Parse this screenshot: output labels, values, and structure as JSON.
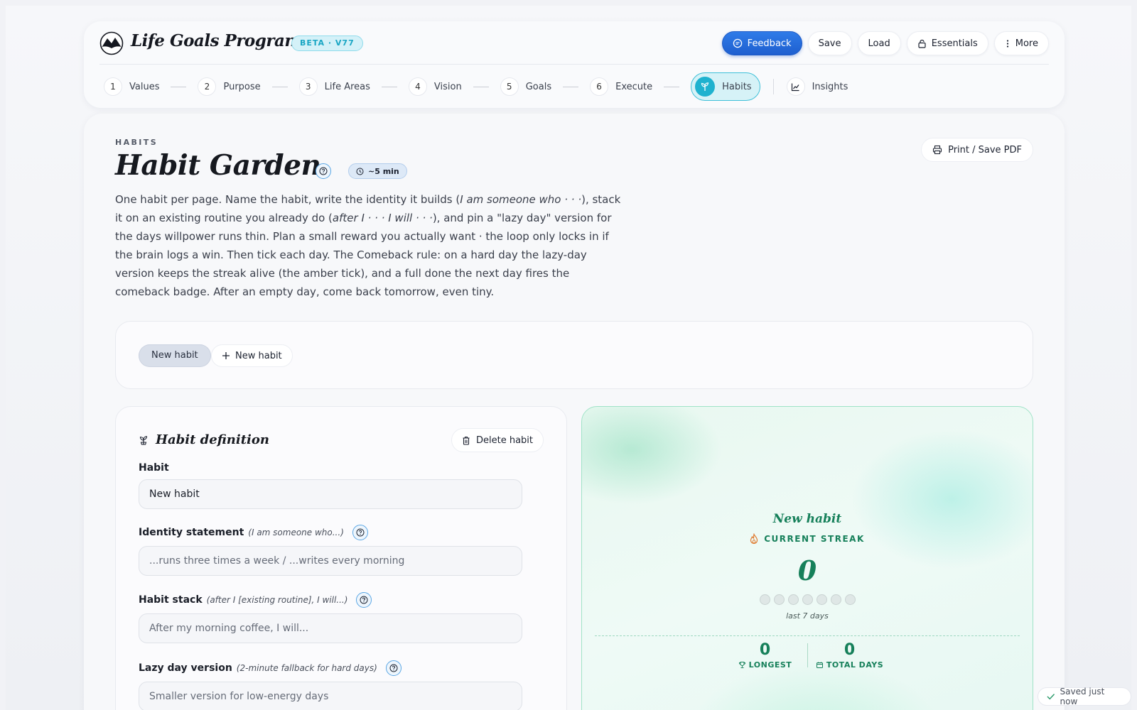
{
  "app": {
    "brand": "Life Goals Program",
    "badge": "BETA · V77"
  },
  "toolbar": {
    "feedback": "Feedback",
    "save": "Save",
    "load": "Load",
    "essentials": "Essentials",
    "more": "More"
  },
  "steps": [
    {
      "num": "1",
      "label": "Values"
    },
    {
      "num": "2",
      "label": "Purpose"
    },
    {
      "num": "3",
      "label": "Life Areas"
    },
    {
      "num": "4",
      "label": "Vision"
    },
    {
      "num": "5",
      "label": "Goals"
    },
    {
      "num": "6",
      "label": "Execute"
    }
  ],
  "active_step": {
    "label": "Habits",
    "icon": "sprout-icon"
  },
  "insights": {
    "label": "Insights",
    "icon": "chart-line-icon"
  },
  "page": {
    "eyebrow": "HABITS",
    "title": "Habit Garden",
    "time": "~5 min",
    "print": "Print / Save PDF",
    "intro_parts": {
      "p1": "One habit per page. Name the habit, write the identity it builds (",
      "e1": "I am someone who · · ·",
      "p2": "), stack it on an existing routine you already do (",
      "e2": "after I · · · I will · · ·",
      "p3": "), and pin a \"lazy day\" version for the days willpower runs thin. Plan a small reward you actually want · the loop only locks in if the brain logs a win. Then tick each day. The Comeback rule: on a hard day the lazy-day version keeps the streak alive (the amber tick), and a full done the next day fires the comeback badge. After an empty day, come back tomorrow, even tiny."
    }
  },
  "habit_tabs": {
    "current": "New habit",
    "new": "New habit"
  },
  "definition": {
    "title": "Habit definition",
    "delete": "Delete habit",
    "habit_label": "Habit",
    "habit_value": "New habit",
    "identity_label": "Identity statement",
    "identity_hint": "(I am someone who...)",
    "identity_placeholder": "...runs three times a week / ...writes every morning",
    "stack_label": "Habit stack",
    "stack_hint": "(after I [existing routine], I will...)",
    "stack_placeholder": "After my morning coffee, I will...",
    "lazy_label": "Lazy day version",
    "lazy_hint": "(2-minute fallback for hard days)",
    "lazy_placeholder": "Smaller version for low-energy days"
  },
  "streak": {
    "name": "New habit",
    "label": "CURRENT STREAK",
    "count": "0",
    "days_shown": 7,
    "caption": "last 7 days",
    "longest_value": "0",
    "longest_label": "LONGEST",
    "total_value": "0",
    "total_label": "TOTAL DAYS"
  },
  "status": {
    "saved": "Saved just now"
  },
  "colors": {
    "accent": "#1fb2cf",
    "primary": "#2f7be8",
    "streak": "#16805a",
    "flame": "#e07a2e"
  }
}
